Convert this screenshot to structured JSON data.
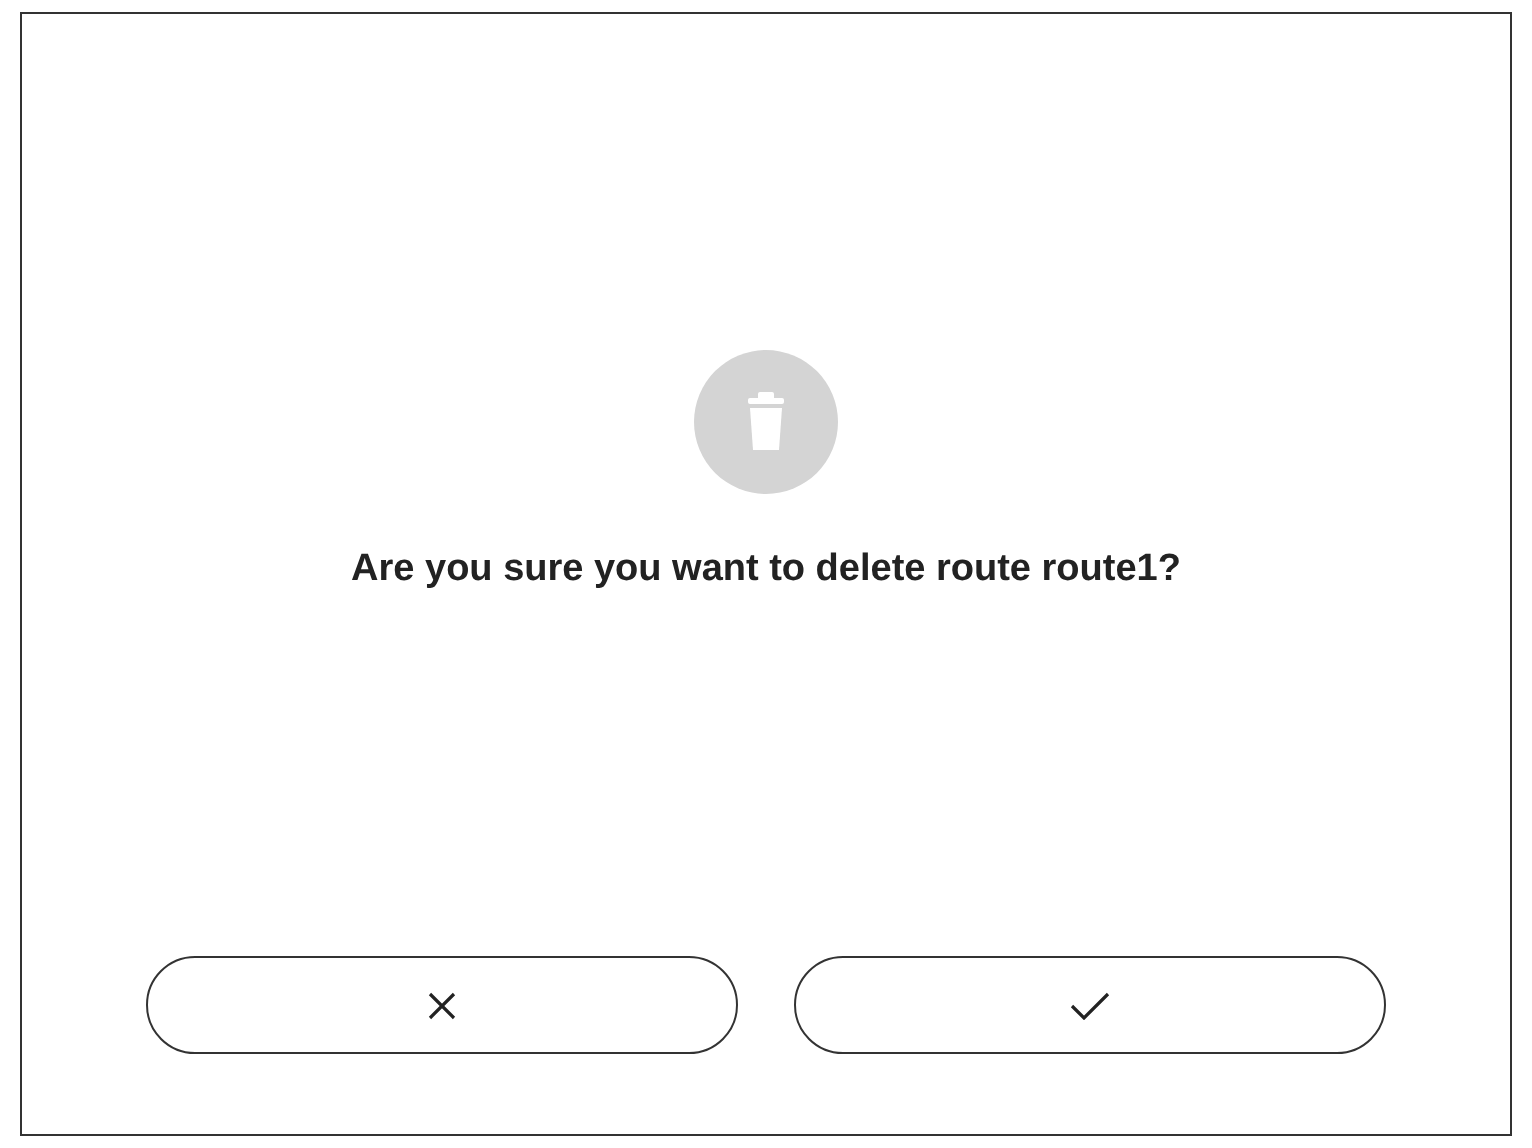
{
  "dialog": {
    "message": "Are you sure you want to delete route route1?"
  },
  "buttons": [
    {
      "kind": "cancel"
    },
    {
      "kind": "confirm"
    }
  ]
}
